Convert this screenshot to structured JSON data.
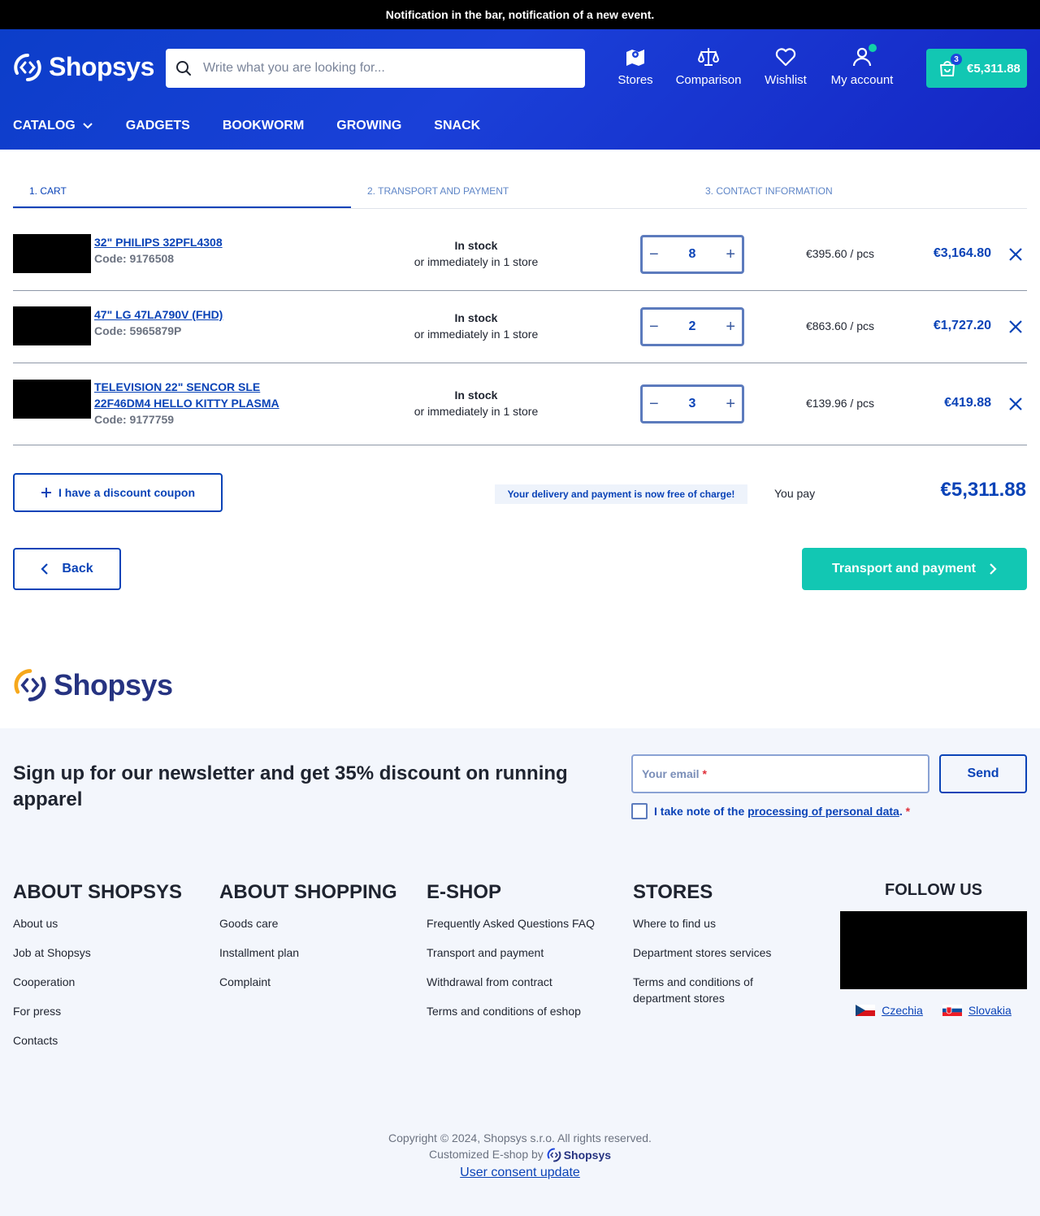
{
  "notification": "Notification in the bar, notification of a new event.",
  "header": {
    "logo_text": "Shopsys",
    "search_placeholder": "Write what you are looking for...",
    "nav": {
      "stores": "Stores",
      "comparison": "Comparison",
      "wishlist": "Wishlist",
      "account": "My account"
    },
    "cart": {
      "count": "3",
      "amount": "€5,311.88"
    },
    "menu": [
      "CATALOG",
      "GADGETS",
      "BOOKWORM",
      "GROWING",
      "SNACK"
    ]
  },
  "steps": [
    "1. CART",
    "2. TRANSPORT AND PAYMENT",
    "3. CONTACT INFORMATION"
  ],
  "cart_items": [
    {
      "name": "32\" PHILIPS 32PFL4308",
      "code": "Code: 9176508",
      "stock": "In stock",
      "store": "or immediately in 1 store",
      "qty": "8",
      "unit_price": "€395.60 / pcs",
      "total": "€3,164.80"
    },
    {
      "name": "47\" LG 47LA790V (FHD)",
      "code": "Code: 5965879P",
      "stock": "In stock",
      "store": "or immediately in 1 store",
      "qty": "2",
      "unit_price": "€863.60 / pcs",
      "total": "€1,727.20"
    },
    {
      "name": "TELEVISION 22\" SENCOR SLE 22F46DM4 HELLO KITTY PLASMA",
      "code": "Code: 9177759",
      "stock": "In stock",
      "store": "or immediately in 1 store",
      "qty": "3",
      "unit_price": "€139.96 / pcs",
      "total": "€419.88"
    }
  ],
  "summary": {
    "coupon": "I have a discount coupon",
    "free_notice": "Your delivery and payment is now free of charge!",
    "you_pay": "You pay",
    "grand_total": "€5,311.88",
    "back": "Back",
    "next": "Transport and payment"
  },
  "footer": {
    "logo_text": "Shopsys",
    "newsletter_title": "Sign up for our newsletter and get 35% discount on running apparel",
    "email_placeholder": "Your email",
    "send": "Send",
    "consent_prefix": "I take note of the",
    "consent_link": "processing of personal data",
    "consent_suffix": ".",
    "columns": [
      {
        "title": "ABOUT SHOPSYS",
        "links": [
          "About us",
          "Job at Shopsys",
          "Cooperation",
          "For press",
          "Contacts"
        ]
      },
      {
        "title": "ABOUT SHOPPING",
        "links": [
          "Goods care",
          "Installment plan",
          "Complaint"
        ]
      },
      {
        "title": "E-SHOP",
        "links": [
          "Frequently Asked Questions FAQ",
          "Transport and payment",
          "Withdrawal from contract",
          "Terms and conditions of eshop"
        ]
      },
      {
        "title": "STORES",
        "links": [
          "Where to find us",
          "Department stores services",
          "Terms and conditions of department stores"
        ]
      }
    ],
    "follow_title": "FOLLOW US",
    "countries": [
      "Czechia",
      "Slovakia"
    ],
    "copyright": "Copyright © 2024, Shopsys s.r.o. All rights reserved.",
    "customized": "Customized E-shop by",
    "brand": "Shopsys",
    "consent_update": "User consent update"
  },
  "colors": {
    "primary": "#0a43b7",
    "accent": "#12c7b3",
    "header": "#1a40d8"
  }
}
